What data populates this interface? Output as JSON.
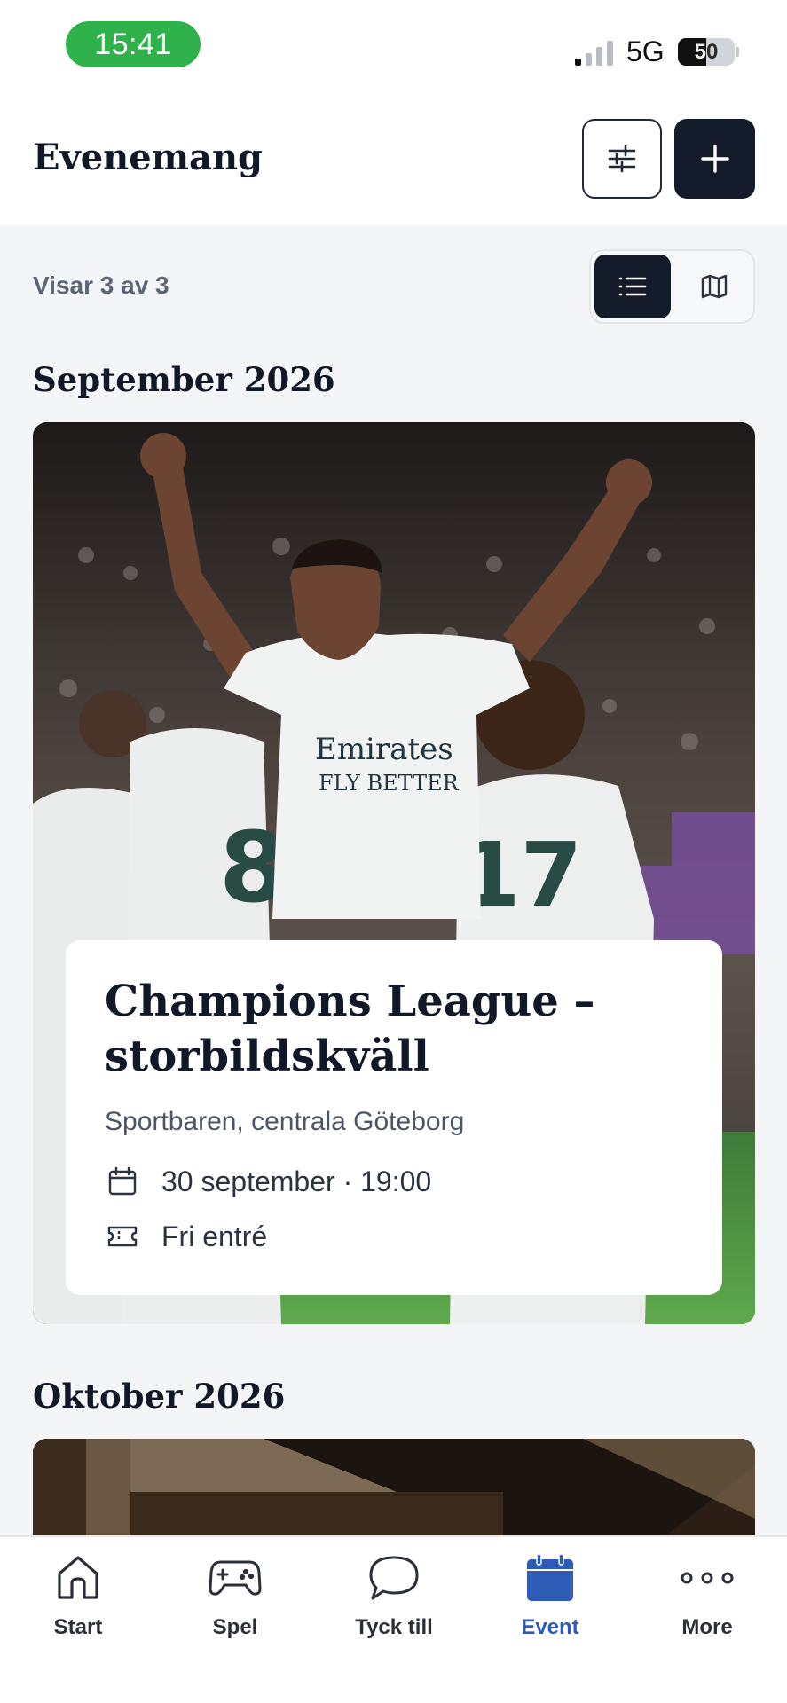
{
  "status_bar": {
    "time": "15:41",
    "network": "5G",
    "battery": "50",
    "battery_level": 0.5,
    "time_pill_color": "#2fb24c"
  },
  "header": {
    "title": "Evenemang",
    "filter_icon": "sliders-icon",
    "add_icon": "plus-icon"
  },
  "toolbar": {
    "results_text": "Visar 3 av 3",
    "view_modes": [
      {
        "name": "list-view",
        "icon": "list-icon",
        "active": true
      },
      {
        "name": "map-view",
        "icon": "map-icon",
        "active": false
      }
    ]
  },
  "sections": [
    {
      "title": "September 2026",
      "events": [
        {
          "title": "Champions League – storbildskväll",
          "venue": "Sportbaren, centrala Göteborg",
          "datetime": "30 september · 19:00",
          "price": "Fri entré",
          "image": "football-celebration-photo"
        }
      ]
    },
    {
      "title": "Oktober 2026",
      "events": [
        {
          "image": "venue-interior-photo"
        }
      ]
    }
  ],
  "bottom_nav": [
    {
      "label": "Start",
      "icon": "home-icon",
      "active": false
    },
    {
      "label": "Spel",
      "icon": "gamepad-icon",
      "active": false
    },
    {
      "label": "Tyck till",
      "icon": "chat-bubble-icon",
      "active": false
    },
    {
      "label": "Event",
      "icon": "calendar-icon",
      "active": true
    },
    {
      "label": "More",
      "icon": "more-dots-icon",
      "active": false
    }
  ],
  "colors": {
    "primary_dark": "#141b2b",
    "active_nav": "#2d5bb5",
    "background": "#f4f5f7"
  }
}
